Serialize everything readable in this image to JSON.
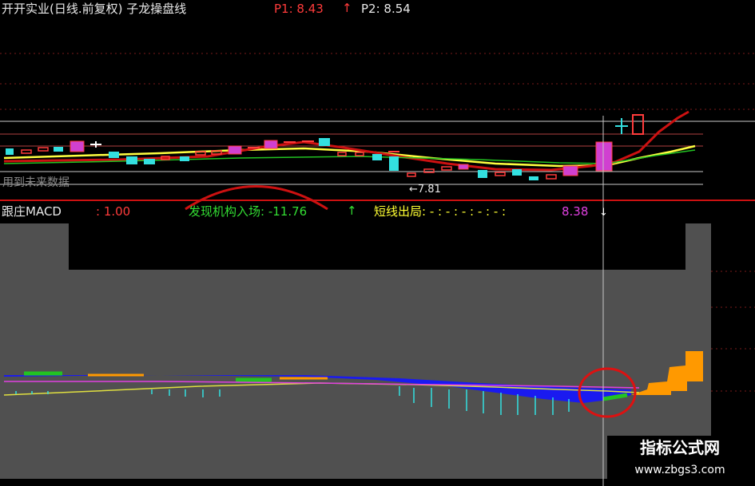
{
  "header": {
    "title": "开开实业(日线.前复权) 子龙操盘线",
    "p1_label": "P1: 8.43",
    "p1_arrow": "↑",
    "p2_label": "P2: 8.54"
  },
  "price_panel": {
    "future_data_note": "用到未来数据",
    "low_marker": "←7.81"
  },
  "macd_header": {
    "label": "跟庄MACD",
    "value": ": 1.00",
    "institution_label": "发现机构入场: -11.76",
    "institution_arrow": "↑",
    "short_label": "短线出局: - : - : - : - : - :",
    "short_value": "8.38",
    "down_arrow": "↓"
  },
  "watermark": {
    "name": "指标公式网",
    "url": "www.zbgs3.com"
  },
  "colors": {
    "background": "#000000",
    "lower_panel": "#505050",
    "bull": "#ff3b3b",
    "bear": "#33e0e0",
    "magenta_candle": "#d040d0",
    "yellow_line": "#ffff40",
    "green": "#22c322",
    "orange": "#ff9900",
    "blue_area": "#1a1af0",
    "annotation_circle": "#dd1111"
  }
}
